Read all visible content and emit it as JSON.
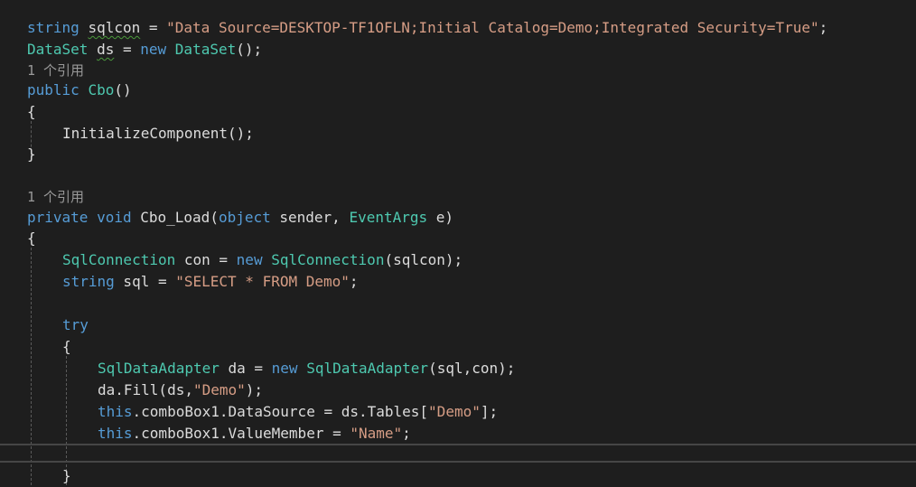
{
  "code": {
    "l1": {
      "kw": "string",
      "name": "sqlcon",
      "eq": " = ",
      "str": "\"Data Source=DESKTOP-TF1OFLN;Initial Catalog=Demo;Integrated Security=True\"",
      "end": ";"
    },
    "l2": {
      "type1": "DataSet",
      "name": "ds",
      "eq": " = ",
      "kw": "new",
      "type2": "DataSet",
      "end": "();"
    },
    "ref1": "1 个引用",
    "l4": {
      "kw": "public",
      "type": "Cbo",
      "end": "()"
    },
    "l5": "{",
    "l6": "InitializeComponent();",
    "l7": "}",
    "ref2": "1 个引用",
    "l9": {
      "kw1": "private",
      "kw2": "void",
      "name": "Cbo_Load(",
      "kw3": "object",
      "mid": " sender, ",
      "type": "EventArgs",
      "end": " e)"
    },
    "l10": "{",
    "l11": {
      "type1": "SqlConnection",
      "mid": " con = ",
      "kw": "new",
      "type2": "SqlConnection",
      "end": "(sqlcon);"
    },
    "l12": {
      "kw": "string",
      "mid": " sql = ",
      "str": "\"SELECT * FROM Demo\"",
      "end": ";"
    },
    "l14": "try",
    "l15": "{",
    "l16": {
      "type1": "SqlDataAdapter",
      "mid": " da = ",
      "kw": "new",
      "type2": "SqlDataAdapter",
      "end": "(sql,con);"
    },
    "l17": {
      "pre": "da.Fill(ds,",
      "str": "\"Demo\"",
      "end": ");"
    },
    "l18": {
      "kw": "this",
      "mid": ".comboBox1.DataSource = ds.Tables[",
      "str": "\"Demo\"",
      "end": "];"
    },
    "l19": {
      "kw": "this",
      "mid": ".comboBox1.ValueMember = ",
      "str": "\"Name\"",
      "end": ";"
    },
    "l21": "}"
  }
}
